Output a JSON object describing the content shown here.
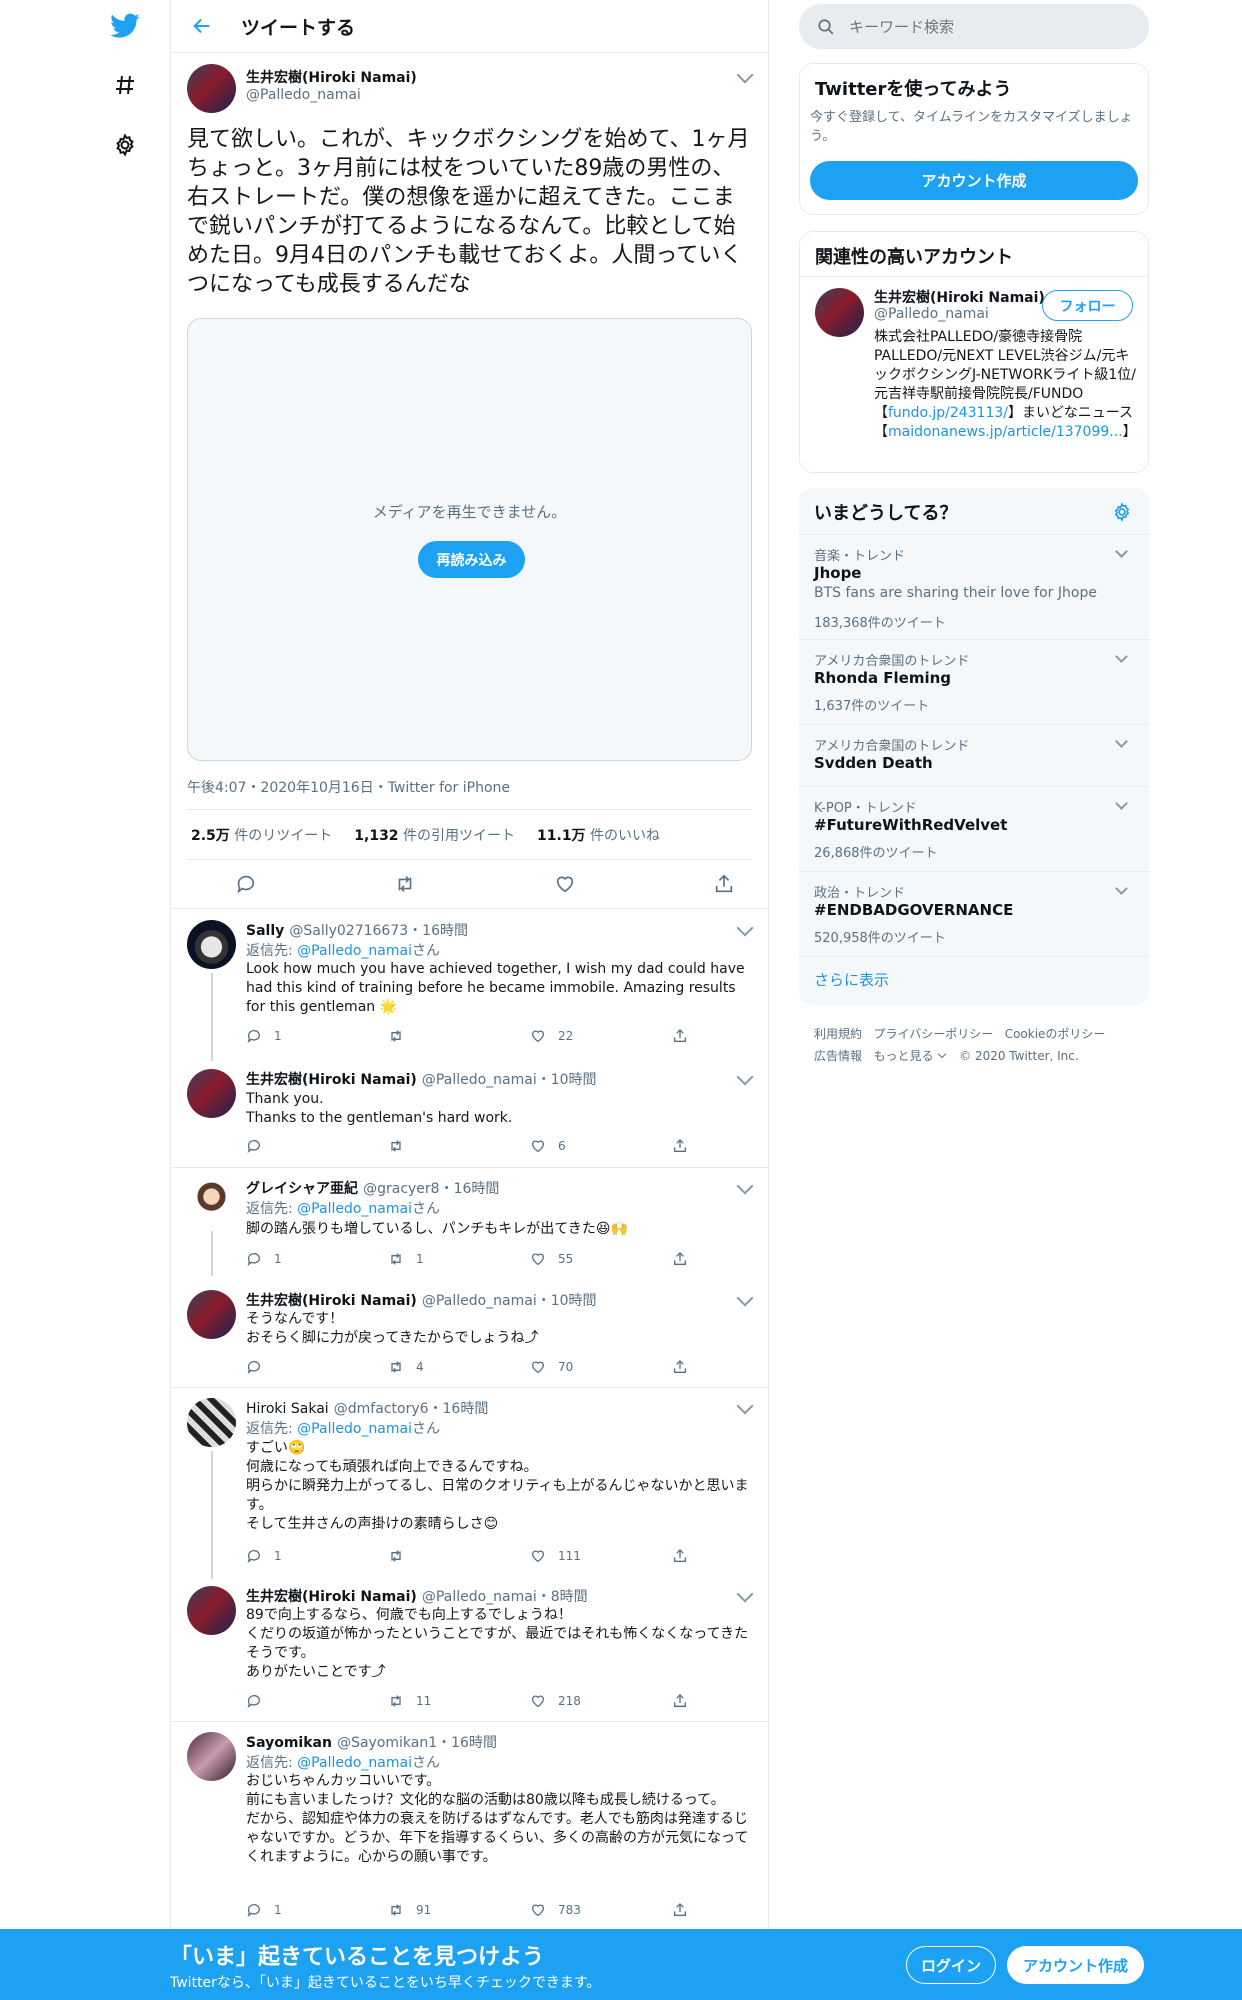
{
  "header": {
    "title": "ツイートする"
  },
  "search": {
    "placeholder": "キーワード検索"
  },
  "focal": {
    "name": "生井宏樹(Hiroki Namai)",
    "handle": "@Palledo_namai",
    "text": "見て欲しい。これが、キックボクシングを始めて、1ヶ月ちょっと。3ヶ月前には杖をついていた89歳の男性の、右ストレートだ。僕の想像を遥かに超えてきた。ここまで鋭いパンチが打てるようになるなんて。比較として始めた日。9月4日のパンチも載せておくよ。人間っていくつになっても成長するんだな",
    "media_error": "メディアを再生できません。",
    "reload_label": "再読み込み",
    "meta": "午後4:07・2020年10月16日・Twitter for iPhone",
    "stats": [
      {
        "value": "2.5万",
        "label": "件のリツイート"
      },
      {
        "value": "1,132",
        "label": "件の引用ツイート"
      },
      {
        "value": "11.1万",
        "label": "件のいいね"
      }
    ]
  },
  "replies": [
    {
      "name": "Sally",
      "handle": "@Sally02716673",
      "time": "・16時間",
      "reply_prefix": "返信先: ",
      "reply_to": "@Palledo_namai",
      "reply_suffix": "さん",
      "text": "Look how much you have achieved together, I wish my dad could have had this kind of training before he became immobile. Amazing results for this gentleman 🌟",
      "reply_count": "1",
      "retweet_count": "",
      "like_count": "22"
    },
    {
      "name": "生井宏樹(Hiroki Namai)",
      "handle": "@Palledo_namai",
      "time": "・10時間",
      "text": "Thank you.\nThanks to the gentleman's hard work.",
      "reply_count": "",
      "retweet_count": "",
      "like_count": "6"
    },
    {
      "name": "グレイシャア亜紀",
      "handle": "@gracyer8",
      "time": "・16時間",
      "reply_prefix": "返信先: ",
      "reply_to": "@Palledo_namai",
      "reply_suffix": "さん",
      "text": "脚の踏ん張りも増しているし、パンチもキレが出てきた😆🙌",
      "reply_count": "1",
      "retweet_count": "1",
      "like_count": "55"
    },
    {
      "name": "生井宏樹(Hiroki Namai)",
      "handle": "@Palledo_namai",
      "time": "・10時間",
      "text": "そうなんです！\nおそらく脚に力が戻ってきたからでしょうね⤴",
      "reply_count": "",
      "retweet_count": "4",
      "like_count": "70"
    },
    {
      "name": "Hiroki Sakai",
      "handle": "@dmfactory6",
      "time": "・16時間",
      "reply_prefix": "返信先: ",
      "reply_to": "@Palledo_namai",
      "reply_suffix": "さん",
      "text": "すごい🙄\n何歳になっても頑張れば向上できるんですね。\n明らかに瞬発力上がってるし、日常のクオリティも上がるんじゃないかと思います。\nそして生井さんの声掛けの素晴らしさ😊",
      "reply_count": "1",
      "retweet_count": "",
      "like_count": "111"
    },
    {
      "name": "生井宏樹(Hiroki Namai)",
      "handle": "@Palledo_namai",
      "time": "・8時間",
      "text": "89で向上するなら、何歳でも向上するでしょうね！\nくだりの坂道が怖かったということですが、最近ではそれも怖くなくなってきたそうです。\nありがたいことです⤴",
      "reply_count": "",
      "retweet_count": "11",
      "like_count": "218"
    },
    {
      "name": "Sayomikan",
      "handle": "@Sayomikan1",
      "time": "・16時間",
      "reply_prefix": "返信先: ",
      "reply_to": "@Palledo_namai",
      "reply_suffix": "さん",
      "text": "おじいちゃんカッコいいです。\n前にも言いましたっけ？文化的な脳の活動は80歳以降も成長し続けるって。\nだから、認知症や体力の衰えを防げるはずなんです。老人でも筋肉は発達するじゃないですか。どうか、年下を指導するくらい、多くの高齢の方が元気になってくれますように。心からの願い事です。",
      "reply_count": "1",
      "retweet_count": "91",
      "like_count": "783"
    }
  ],
  "signup": {
    "title": "Twitterを使ってみよう",
    "desc": "今すぐ登録して、タイムラインをカスタマイズしましょう。",
    "button": "アカウント作成"
  },
  "relevant": {
    "title": "関連性の高いアカウント",
    "name": "生井宏樹(Hiroki Namai)",
    "handle": "@Palledo_namai",
    "follow": "フォロー",
    "bio_1": "株式会社PALLEDO/豪徳寺接骨院PALLEDO/元NEXT LEVEL渋谷ジム/元キックボクシングJ-NETWORKライト級1位/元吉祥寺駅前接骨院院長/FUNDO【",
    "bio_link1": "fundo.jp/243113/",
    "bio_2": "】まいどなニュース【",
    "bio_link2": "maidonanews.jp/article/137099...",
    "bio_3": "】"
  },
  "trends": {
    "title": "いまどうしてる？",
    "items": [
      {
        "context": "音楽・トレンド",
        "name": "Jhope",
        "desc": "BTS fans are sharing their love for Jhope",
        "count": "183,368件のツイート"
      },
      {
        "context": "アメリカ合衆国のトレンド",
        "name": "Rhonda Fleming",
        "desc": "",
        "count": "1,637件のツイート"
      },
      {
        "context": "アメリカ合衆国のトレンド",
        "name": "Svdden Death",
        "desc": "",
        "count": ""
      },
      {
        "context": "K-POP・トレンド",
        "name": "#FutureWithRedVelvet",
        "desc": "",
        "count": "26,868件のツイート"
      },
      {
        "context": "政治・トレンド",
        "name": "#ENDBADGOVERNANCE",
        "desc": "",
        "count": "520,958件のツイート"
      }
    ],
    "more": "さらに表示"
  },
  "footer": {
    "links": [
      "利用規約",
      "プライバシーポリシー",
      "Cookieのポリシー",
      "広告情報",
      "もっと見る"
    ],
    "copyright": "© 2020 Twitter, Inc."
  },
  "bottombar": {
    "title": "「いま」起きていることを見つけよう",
    "subtitle": "Twitterなら、「いま」起きていることをいち早くチェックできます。",
    "login": "ログイン",
    "signup": "アカウント作成"
  },
  "colors": {
    "accent": "#1da1f2",
    "link": "#1b95e0"
  }
}
